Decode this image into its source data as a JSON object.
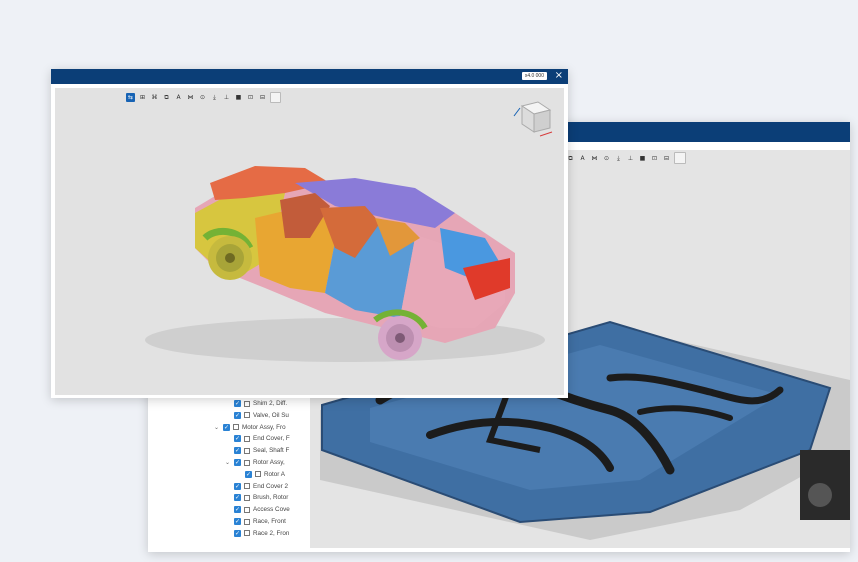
{
  "front_window": {
    "zoom_value": "x4.0 000",
    "close_glyph": "×",
    "toolbar": [
      "⇆",
      "⊞",
      "⌘",
      "⧉",
      "A",
      "⋈",
      "⊙",
      "⤓",
      "⊥",
      "■",
      "⊡",
      "⊟",
      ""
    ]
  },
  "back_window": {
    "toolbar": [
      "⧉",
      "A",
      "⋈",
      "⊙",
      "⤓",
      "⊥",
      "■",
      "⊡",
      "⊟",
      ""
    ]
  },
  "tree": [
    {
      "label": "Shim 2, Diff.",
      "indent": 1,
      "caret": ""
    },
    {
      "label": "Valve, Oil Su",
      "indent": 1,
      "caret": ""
    },
    {
      "label": "Motor Assy, Fro",
      "indent": 0,
      "caret": "⌄"
    },
    {
      "label": "End Cover, F",
      "indent": 1,
      "caret": ""
    },
    {
      "label": "Seal, Shaft F",
      "indent": 1,
      "caret": ""
    },
    {
      "label": "Rotor Assy,",
      "indent": 1,
      "caret": "⌄"
    },
    {
      "label": "Rotor A",
      "indent": 2,
      "caret": ""
    },
    {
      "label": "End Cover 2",
      "indent": 1,
      "caret": ""
    },
    {
      "label": "Brush, Rotor",
      "indent": 1,
      "caret": ""
    },
    {
      "label": "Access Cove",
      "indent": 1,
      "caret": ""
    },
    {
      "label": "Race, Front",
      "indent": 1,
      "caret": ""
    },
    {
      "label": "Race 2, Fron",
      "indent": 1,
      "caret": ""
    }
  ],
  "colors": {
    "titlebar": "#0b3e77",
    "checkbox": "#2a82d4",
    "viewport_bg": "#e2e2e2",
    "battery_blue": "#3f6fa3"
  },
  "icons": [
    "close-icon",
    "view-cube-icon",
    "checkbox-icon",
    "part-icon"
  ]
}
